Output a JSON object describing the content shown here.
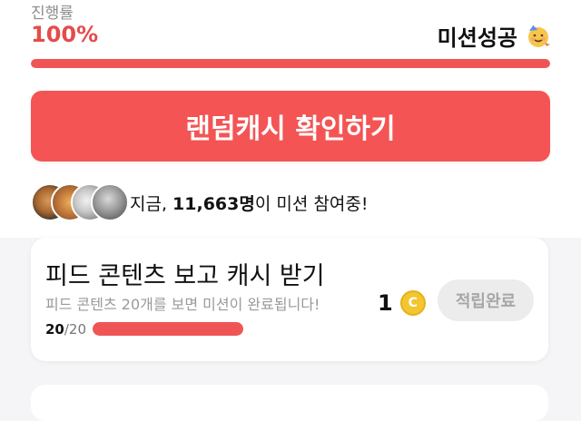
{
  "progress": {
    "label": "진행률",
    "value": "100%",
    "fraction": 1.0,
    "status_text": "미션성공",
    "status_icon": "party-face-icon"
  },
  "random_cash": {
    "button_label": "랜덤캐시 확인하기"
  },
  "participants": {
    "prefix": "지금, ",
    "count": "11,663명",
    "suffix": "이 미션 참여중!",
    "avatars": [
      "avatar-1",
      "avatar-2",
      "avatar-3",
      "avatar-4"
    ]
  },
  "mission": {
    "title": "피드 콘텐츠 보고 캐시 받기",
    "description": "피드 콘텐츠 20개를 보면 미션이 완료됩니다!",
    "progress_current": "20",
    "progress_total": "/20",
    "progress_fraction": 1.0,
    "reward_amount": "1",
    "reward_icon": "cash-coin-icon",
    "action_label": "적립완료"
  },
  "colors": {
    "accent": "#f45454",
    "progress_track": "#f1d3d3",
    "coin": "#f3c530"
  }
}
